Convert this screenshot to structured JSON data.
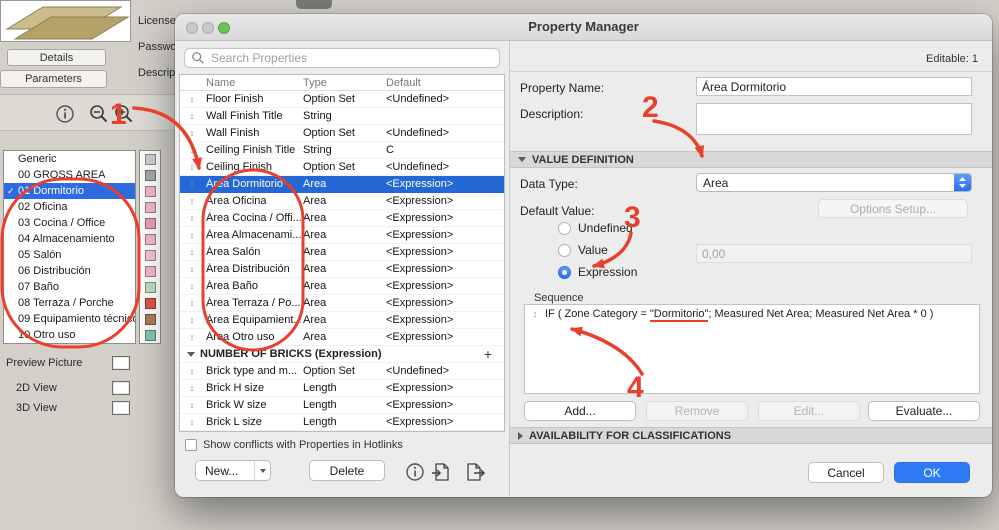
{
  "background": {
    "license_label": "License:",
    "password_label": "Password:",
    "description_label": "Description:",
    "details_button": "Details",
    "parameters_button": "Parameters",
    "zones": [
      {
        "label": "Generic",
        "swatch": "#d0d0d0",
        "check": ""
      },
      {
        "label": "00 GROSS AREA",
        "swatch": "#a8a8a8",
        "check": ""
      },
      {
        "label": "01 Dormitorio",
        "swatch": "#f3b9ca",
        "check": "✓",
        "selected": true
      },
      {
        "label": "02 Oficina",
        "swatch": "#f3b9ca",
        "check": ""
      },
      {
        "label": "03 Cocina / Office",
        "swatch": "#ee9cba",
        "check": ""
      },
      {
        "label": "04 Almacenamiento",
        "swatch": "#f3b9ca",
        "check": ""
      },
      {
        "label": "05 Salón",
        "swatch": "#f5c4d2",
        "check": ""
      },
      {
        "label": "06 Distribución",
        "swatch": "#f3b9ca",
        "check": ""
      },
      {
        "label": "07 Baño",
        "swatch": "#bfe0b8",
        "check": ""
      },
      {
        "label": "08 Terraza / Porche",
        "swatch": "#de5448",
        "check": ""
      },
      {
        "label": "09 Equipamiento técnico",
        "swatch": "#a97e58",
        "check": ""
      },
      {
        "label": "10 Otro uso",
        "swatch": "#7ec9b2",
        "check": ""
      }
    ],
    "preview_picture_label": "Preview Picture",
    "view2d_label": "2D View",
    "view3d_label": "3D View"
  },
  "dialog": {
    "title": "Property Manager",
    "search": {
      "placeholder": "Search Properties"
    },
    "table": {
      "columns": {
        "name": "Name",
        "type": "Type",
        "default": "Default"
      },
      "rows": [
        {
          "name": "Floor Finish",
          "type": "Option Set",
          "default": "<Undefined>"
        },
        {
          "name": "Wall Finish Title",
          "type": "String",
          "default": ""
        },
        {
          "name": "Wall Finish",
          "type": "Option Set",
          "default": "<Undefined>"
        },
        {
          "name": "Ceiling Finish Title",
          "type": "String",
          "default": "C"
        },
        {
          "name": "Ceiling Finish",
          "type": "Option Set",
          "default": "<Undefined>"
        },
        {
          "name": "Área Dormitorio",
          "type": "Area",
          "default": "<Expression>",
          "selected": true
        },
        {
          "name": "Área Oficina",
          "type": "Area",
          "default": "<Expression>"
        },
        {
          "name": "Área Cocina / Offi...",
          "type": "Area",
          "default": "<Expression>"
        },
        {
          "name": "Área Almacenami...",
          "type": "Area",
          "default": "<Expression>"
        },
        {
          "name": "Área Salón",
          "type": "Area",
          "default": "<Expression>"
        },
        {
          "name": "Área Distribución",
          "type": "Area",
          "default": "<Expression>"
        },
        {
          "name": "Área Baño",
          "type": "Area",
          "default": "<Expression>"
        },
        {
          "name": "Área Terraza / Po...",
          "type": "Area",
          "default": "<Expression>"
        },
        {
          "name": "Área Equipamient...",
          "type": "Area",
          "default": "<Expression>"
        },
        {
          "name": "Área Otro uso",
          "type": "Area",
          "default": "<Expression>"
        }
      ],
      "group_header": "NUMBER OF BRICKS (Expression)",
      "group_rows": [
        {
          "name": "Brick type and m...",
          "type": "Option Set",
          "default": "<Undefined>"
        },
        {
          "name": "Brick H size",
          "type": "Length",
          "default": "<Expression>"
        },
        {
          "name": "Brick W size",
          "type": "Length",
          "default": "<Expression>"
        },
        {
          "name": "Brick L size",
          "type": "Length",
          "default": "<Expression>"
        }
      ]
    },
    "footer": {
      "conflicts_label": "Show conflicts with Properties in Hotlinks",
      "new_button": "New...",
      "delete_button": "Delete"
    },
    "right": {
      "editable_label": "Editable: 1",
      "property_name_label": "Property Name:",
      "property_name_value": "Área Dormitorio",
      "description_label": "Description:",
      "value_definition_header": "VALUE DEFINITION",
      "data_type_label": "Data Type:",
      "data_type_value": "Area",
      "default_value_label": "Default Value:",
      "options_setup_button": "Options Setup...",
      "undefined_radio_label": "Undefined",
      "value_radio_label": "Value",
      "value_field_value": "0,00",
      "expression_radio_label": "Expression",
      "sequence_label": "Sequence",
      "expression_before": "IF ( Zone Category = ",
      "expression_highlight": "\"Dormitorio\"",
      "expression_after": "; Measured Net Area; Measured Net Area * 0 )",
      "add_button": "Add...",
      "remove_button": "Remove",
      "edit_button": "Edit...",
      "evaluate_button": "Evaluate...",
      "availability_header": "AVAILABILITY FOR CLASSIFICATIONS",
      "cancel_button": "Cancel",
      "ok_button": "OK"
    }
  },
  "annotations": {
    "step1": "1",
    "step2": "2",
    "step3": "3",
    "step4": "4",
    "color": "#e8402c"
  }
}
